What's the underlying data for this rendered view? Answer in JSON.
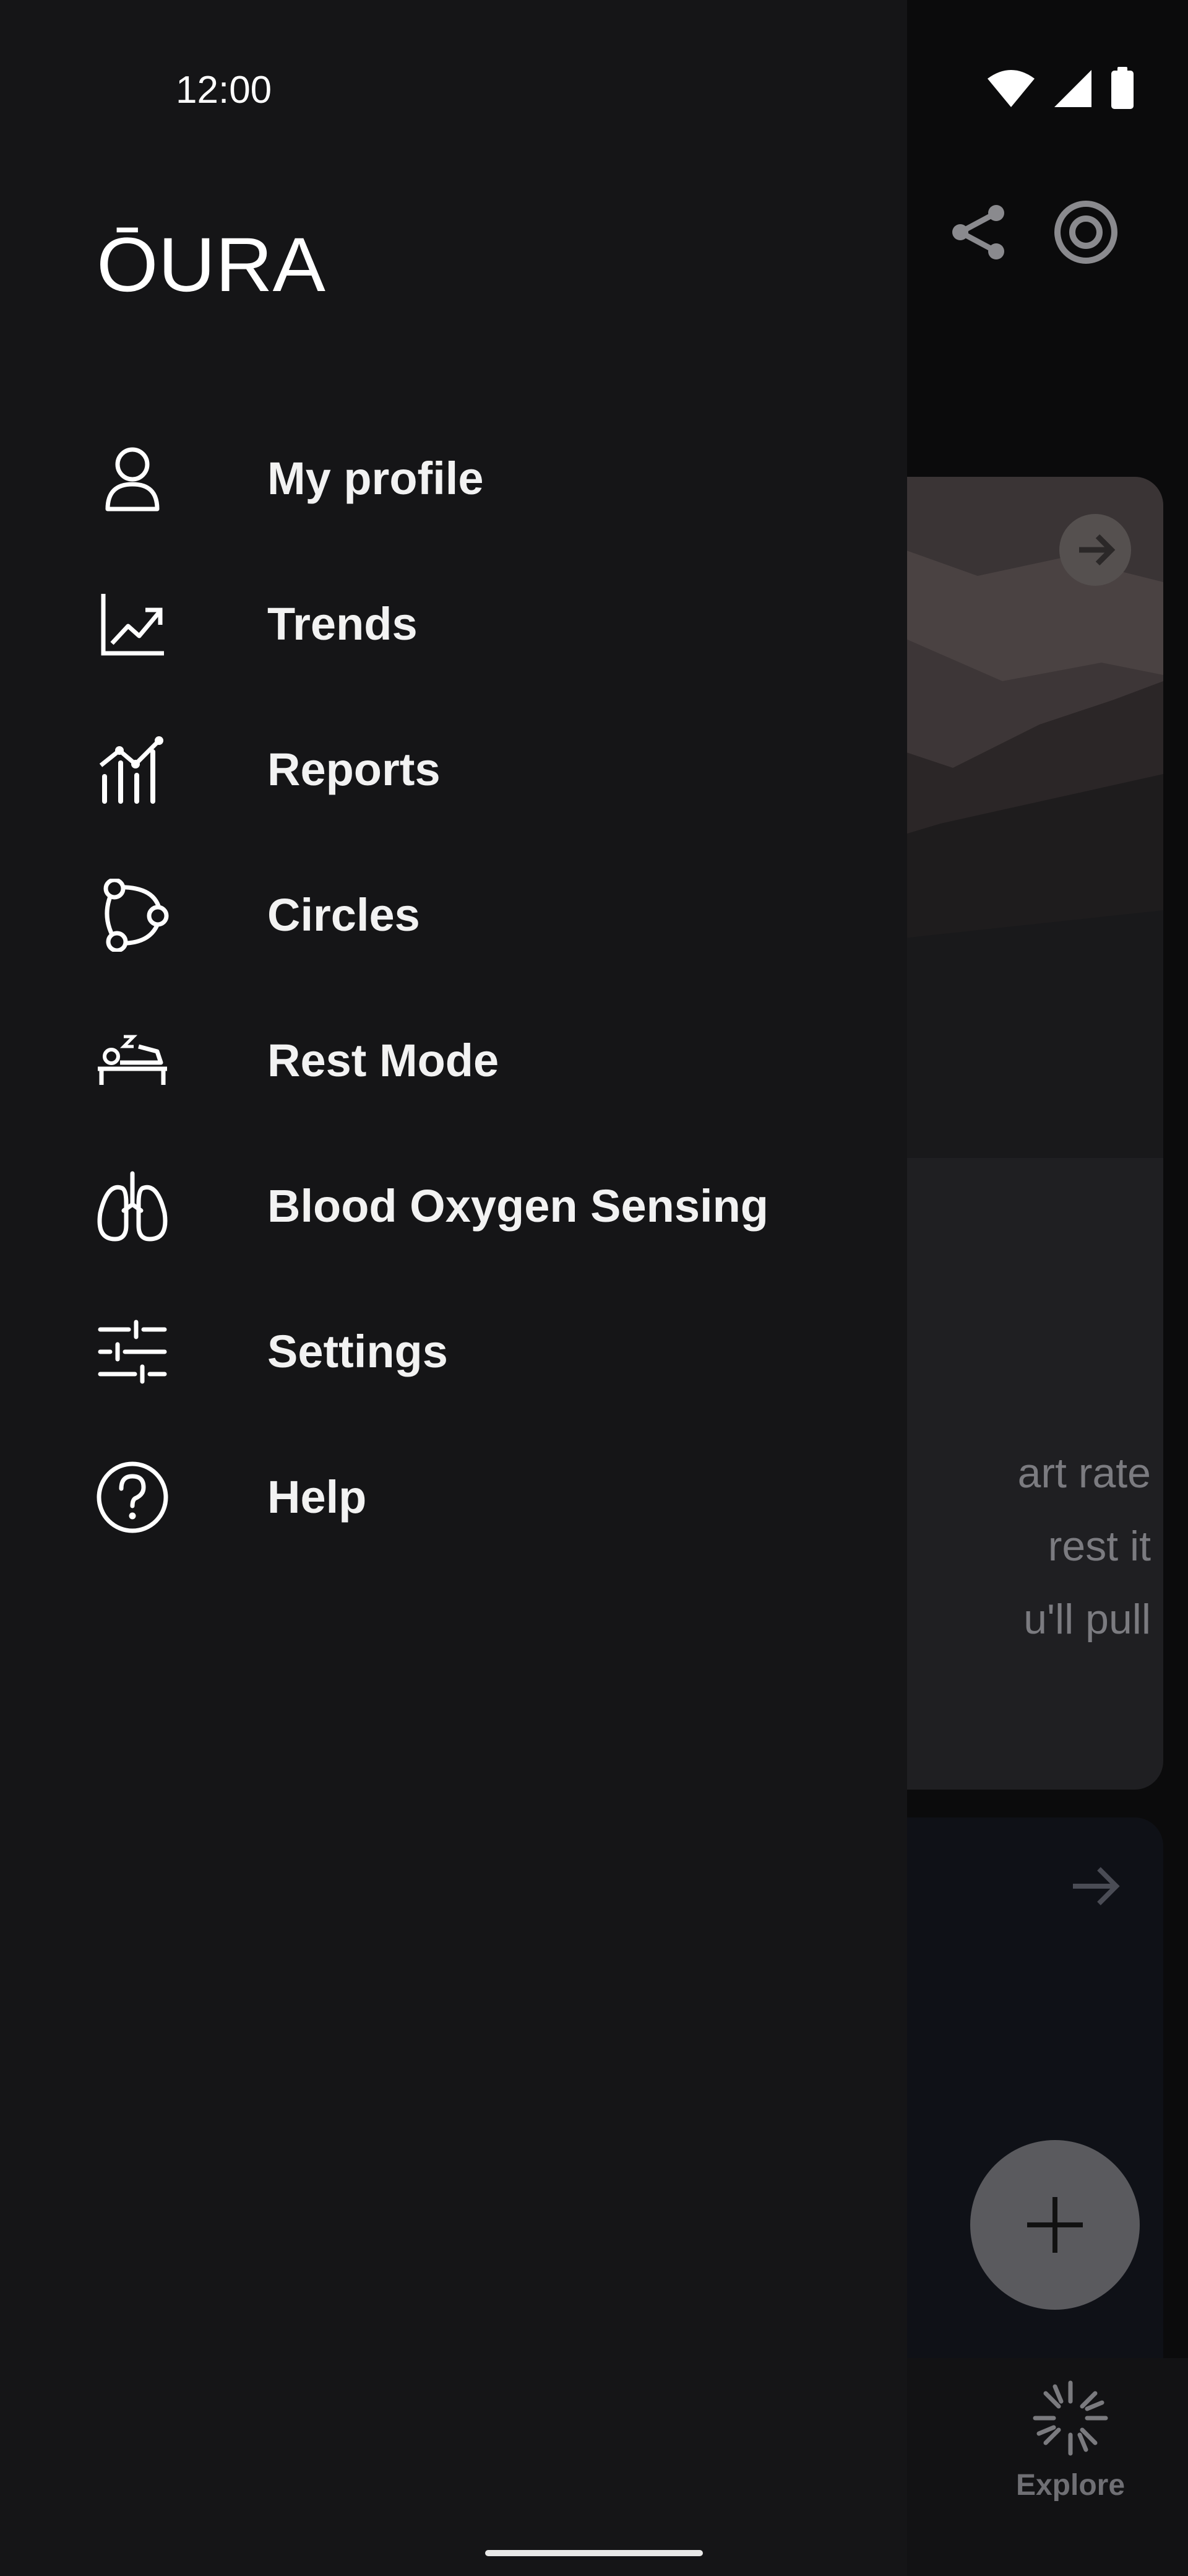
{
  "status_bar": {
    "time": "12:00"
  },
  "drawer": {
    "brand": "ŌURA",
    "menu": [
      {
        "label": "My profile",
        "icon": "person-icon"
      },
      {
        "label": "Trends",
        "icon": "trend-chart-icon"
      },
      {
        "label": "Reports",
        "icon": "reports-chart-icon"
      },
      {
        "label": "Circles",
        "icon": "circles-icon"
      },
      {
        "label": "Rest Mode",
        "icon": "rest-bed-icon"
      },
      {
        "label": "Blood Oxygen Sensing",
        "icon": "lungs-icon"
      },
      {
        "label": "Settings",
        "icon": "sliders-icon"
      },
      {
        "label": "Help",
        "icon": "help-circle-icon"
      }
    ]
  },
  "background": {
    "card_text_lines": [
      "art rate",
      "rest it",
      "u'll pull"
    ],
    "explore_label": "Explore"
  },
  "colors": {
    "drawer_bg": "#151517",
    "text": "#f2f2f2",
    "muted": "#7b7b80"
  }
}
